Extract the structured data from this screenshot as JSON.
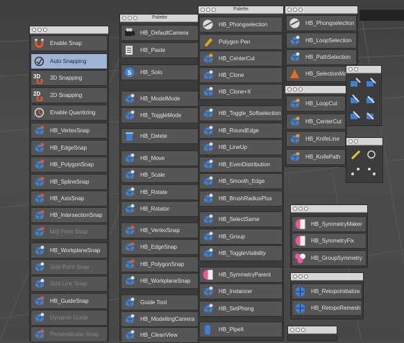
{
  "windows": {
    "palette_b_title": "Palette",
    "palette_c_title": "Palette"
  },
  "snap": {
    "items": [
      {
        "label": "Enable Snap",
        "icon": "magnet-icon"
      },
      {
        "label": "Auto Snapping",
        "icon": "auto-snap-icon"
      },
      {
        "label": "3D Snapping",
        "icon": "3d-snap-icon"
      },
      {
        "label": "2D Snapping",
        "icon": "2d-snap-icon"
      },
      {
        "label": "Enable Quantizing",
        "icon": "quantize-icon"
      },
      {
        "label": "HB_VertexSnap",
        "icon": "vertex-snap-icon"
      },
      {
        "label": "HB_EdgeSnap",
        "icon": "edge-snap-icon"
      },
      {
        "label": "HB_PolygonSnap",
        "icon": "polygon-snap-icon"
      },
      {
        "label": "HB_SplineSnap",
        "icon": "spline-snap-icon"
      },
      {
        "label": "HB_AxisSnap",
        "icon": "axis-snap-icon"
      },
      {
        "label": "HB_IntersectionSnap",
        "icon": "intersection-snap-icon"
      },
      {
        "label": "Mid Point Snap",
        "icon": "midpoint-snap-icon"
      },
      {
        "label": "HB_WorkplaneSnap",
        "icon": "workplane-snap-icon"
      },
      {
        "label": "Grid Point Snap",
        "icon": "grid-point-icon"
      },
      {
        "label": "Grid Line Snap",
        "icon": "grid-line-icon"
      },
      {
        "label": "HB_GuideSnap",
        "icon": "guide-snap-icon"
      },
      {
        "label": "Dynamic Guide",
        "icon": "dynamic-guide-icon"
      },
      {
        "label": "Perpendicular Snap",
        "icon": "perpendicular-snap-icon"
      }
    ]
  },
  "tools": {
    "items": [
      {
        "label": "HB_DefaultCamera",
        "icon": "camera-icon"
      },
      {
        "label": "HB_Paste",
        "icon": "paste-icon"
      },
      {
        "label": "HB_Solo",
        "icon": "solo-icon"
      },
      {
        "label": "HB_ModelMode",
        "icon": "model-mode-icon"
      },
      {
        "label": "HB_ToggleMode",
        "icon": "toggle-mode-icon"
      },
      {
        "label": "HB_Delete",
        "icon": "trash-icon"
      },
      {
        "label": "HB_Move",
        "icon": "move-icon"
      },
      {
        "label": "HB_Scale",
        "icon": "scale-icon"
      },
      {
        "label": "HB_Rotate",
        "icon": "rotate-icon"
      },
      {
        "label": "HB_Rotator",
        "icon": "rotator-icon"
      },
      {
        "label": "HB_VertexSnap",
        "icon": "vertex-snap-icon"
      },
      {
        "label": "HB_EdgeSnap",
        "icon": "edge-snap-icon"
      },
      {
        "label": "HB_PolygonSnap",
        "icon": "polygon-snap-icon"
      },
      {
        "label": "HB_WorkplaneSnap",
        "icon": "workplane-snap-icon"
      },
      {
        "label": "Guide Tool",
        "icon": "guide-tool-icon"
      },
      {
        "label": "HB_ModellingCamera",
        "icon": "modelling-camera-icon"
      },
      {
        "label": "HB_CleanView",
        "icon": "clean-view-icon"
      }
    ]
  },
  "modeling": {
    "items": [
      {
        "label": "HB_Phongselection",
        "icon": "phong-icon"
      },
      {
        "label": "Polygon Pen",
        "icon": "polygon-pen-icon"
      },
      {
        "label": "HB_CenterCut",
        "icon": "center-cut-icon"
      },
      {
        "label": "HB_Clone",
        "icon": "clone-icon"
      },
      {
        "label": "HB_Clone+X",
        "icon": "clone-x-icon"
      },
      {
        "label": "HB_Toggle_Softselection",
        "icon": "soft-selection-icon"
      },
      {
        "label": "HB_RoundEdge",
        "icon": "round-edge-icon"
      },
      {
        "label": "HB_LineUp",
        "icon": "line-up-icon"
      },
      {
        "label": "HB_EvenDistribution",
        "icon": "even-distribution-icon"
      },
      {
        "label": "HB_Smooth_Edge",
        "icon": "smooth-edge-icon"
      },
      {
        "label": "HB_BrushRadiusPlus",
        "icon": "brush-radius-icon"
      },
      {
        "label": "HB_SelectSame",
        "icon": "select-same-icon"
      },
      {
        "label": "HB_Group",
        "icon": "group-icon"
      },
      {
        "label": "HB_ToggleVisibility",
        "icon": "visibility-icon"
      },
      {
        "label": "HB_SymmetryParent",
        "icon": "symmetry-parent-icon"
      },
      {
        "label": "HB_Instancer",
        "icon": "instancer-icon"
      },
      {
        "label": "HB_SetPhong",
        "icon": "set-phong-icon"
      },
      {
        "label": "HB_PipeIt",
        "icon": "pipe-icon"
      }
    ]
  },
  "selection": {
    "items": [
      {
        "label": "HB_Phongselection",
        "icon": "phong-icon"
      },
      {
        "label": "HB_LoopSelection",
        "icon": "loop-selection-icon"
      },
      {
        "label": "HB_PathSelection",
        "icon": "path-selection-icon"
      },
      {
        "label": "HB_SelectionMaker",
        "icon": "selection-maker-icon"
      }
    ]
  },
  "knife": {
    "items": [
      {
        "label": "HB_LoopCut",
        "icon": "loop-cut-icon"
      },
      {
        "label": "HB_CenterCut",
        "icon": "center-cut-icon"
      },
      {
        "label": "HB_KnifeLine",
        "icon": "knife-line-icon"
      },
      {
        "label": "HB_KnifePath",
        "icon": "knife-path-icon"
      }
    ]
  },
  "symmetry": {
    "items": [
      {
        "label": "HB_SymmetryMaker",
        "icon": "symmetry-maker-icon"
      },
      {
        "label": "HB_SymmetryFix",
        "icon": "symmetry-fix-icon"
      },
      {
        "label": "HB_GroupSymmetry",
        "icon": "group-symmetry-icon"
      }
    ]
  },
  "retopo": {
    "items": [
      {
        "label": "HB_RetopoInitialize",
        "icon": "retopo-init-icon"
      },
      {
        "label": "HB_RetopoRemesh",
        "icon": "retopo-remesh-icon"
      }
    ]
  },
  "colors": {
    "selected_bg": "#9fb4d4",
    "button_bg": "#555555",
    "titlebar": "#d6d6d6",
    "symmetry_pink": "#e85a9c",
    "retopo_blue": "#3f7fd6"
  }
}
